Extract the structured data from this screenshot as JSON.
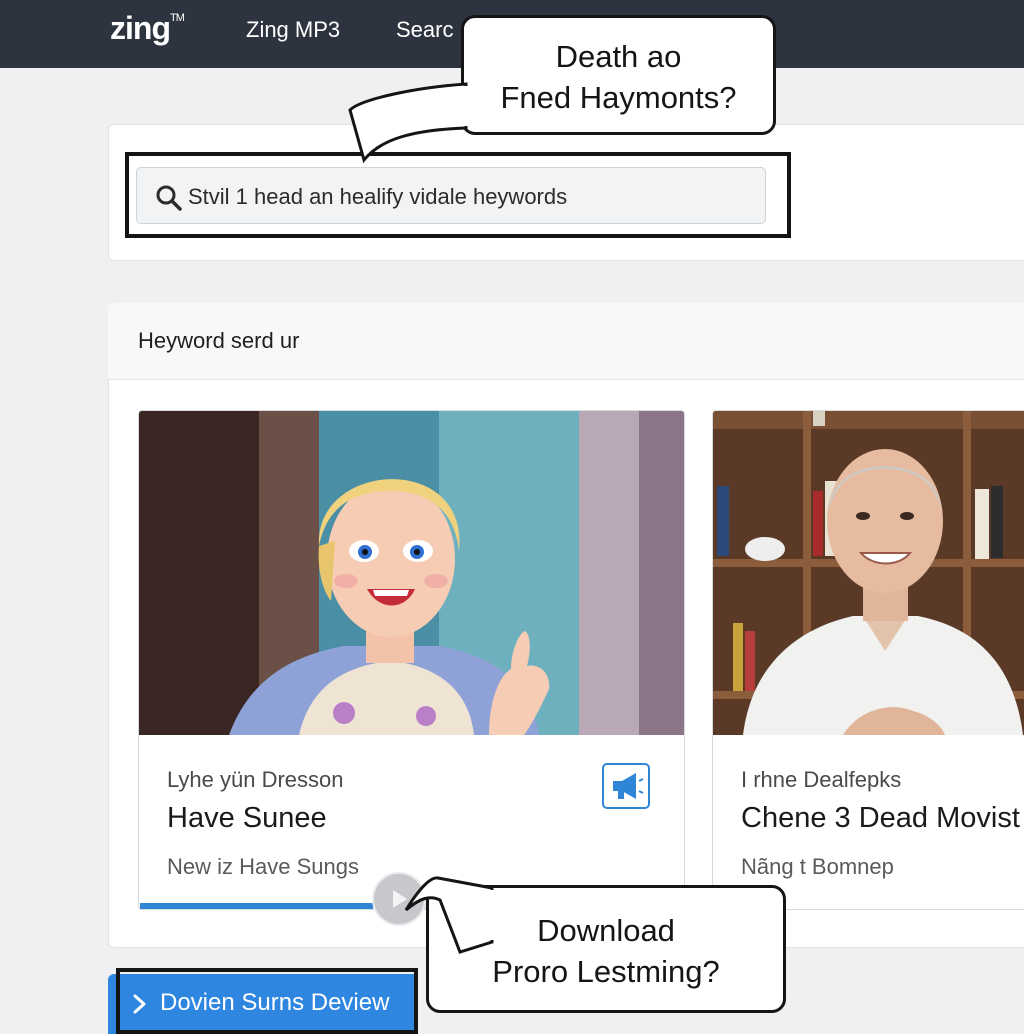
{
  "header": {
    "logo": "zing",
    "logo_mark": "TM",
    "nav": [
      "Zing MP3",
      "Searc"
    ]
  },
  "bubbles": {
    "top": {
      "line1": "Death ao",
      "line2": "Fned Haymonts?"
    },
    "bottom": {
      "line1": "Download",
      "line2": "Proro Lestming?"
    }
  },
  "search": {
    "value": "Stvil 1 head an healify vidale heywords"
  },
  "results": {
    "title": "Heyword serd ur",
    "cards": [
      {
        "subtitle": "Lyhe yün Dresson",
        "title": "Have Sunee",
        "meta": "New iz Have Sungs",
        "progress": 0.43
      },
      {
        "subtitle": "I rhne Dealfepks",
        "title": "Chene 3 Dead Movist",
        "meta": "Nãng t Bomnep"
      }
    ]
  },
  "action_button": {
    "label": "Dovien Surns Deview"
  },
  "icons": [
    "search-icon",
    "megaphone-icon",
    "chevron-right-icon",
    "play-icon"
  ],
  "colors": {
    "topbar": "#2d3440",
    "accent": "#2f86e0",
    "background": "#eef0f2"
  }
}
